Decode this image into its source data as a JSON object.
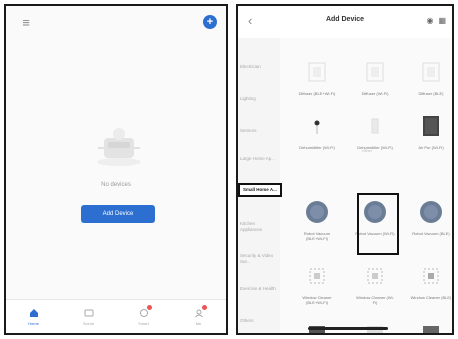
{
  "home": {
    "empty_text": "No devices",
    "add_button": "Add Device",
    "tabs": [
      {
        "label": "Home",
        "icon": "home-icon",
        "active": true
      },
      {
        "label": "Scene",
        "icon": "scene-icon",
        "active": false
      },
      {
        "label": "Smart",
        "icon": "smart-icon",
        "active": false
      },
      {
        "label": "Me",
        "icon": "profile-icon",
        "active": false
      }
    ]
  },
  "add_device": {
    "title": "Add Device",
    "categories": [
      "Electrician",
      "Lighting",
      "Sensors",
      "Large Home Ap...",
      "Small Home A...",
      "Kitchen Appliances",
      "Security & Video Sur...",
      "Exercise & Health",
      "Others"
    ],
    "selected_category": "Small Home A...",
    "group_label": "Other",
    "rows": [
      [
        "Diffuser (BLE+Wi-Fi)",
        "Diffuser (Wi-Fi)",
        "Diffuser (BLE)"
      ],
      [
        "Dehumidifier (Wi-Fi)",
        "Dehumidifier (Wi-Fi)",
        "Air Pur (Wi-Fi)"
      ],
      [
        "Robot Vacuum (BLE+Wi-Fi)",
        "Robot Vacuum (Wi-Fi)",
        "Robot Vacuum (BLE)"
      ],
      [
        "Window Cleaner (BLE+Wi-Fi)",
        "Window Cleaner (Wi-Fi)",
        "Window Cleaner (BLE)"
      ],
      [
        "",
        "",
        ""
      ]
    ]
  },
  "colors": {
    "accent": "#2d6fd0",
    "badge": "#e55555"
  }
}
